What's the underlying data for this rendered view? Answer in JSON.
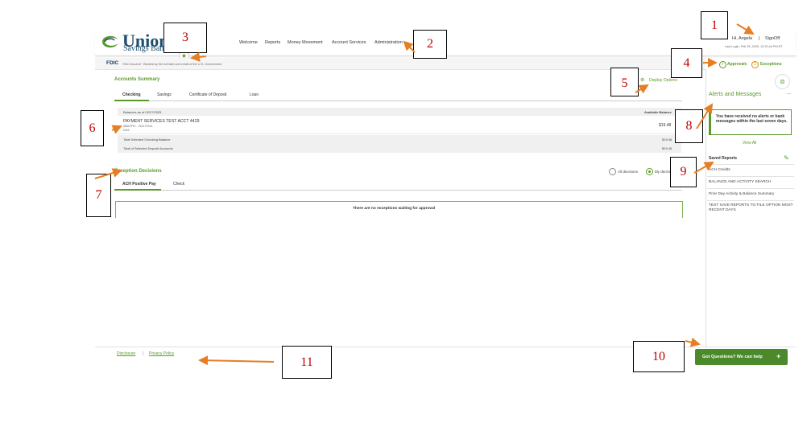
{
  "bank": {
    "name_top": "Union",
    "name_bottom": "Savings Bank"
  },
  "nav": [
    "Welcome",
    "Reports",
    "Money Movement",
    "Account Services",
    "Administration"
  ],
  "user": {
    "greeting": "Hi, Angela",
    "separator": "|",
    "signoff": "SignOff",
    "last_login": "Last Login: Feb 25, 2025, 12:20:44 PM ET"
  },
  "fdic": {
    "logo": "FDIC",
    "text": "FDIC-Insured · Backed by the full faith and credit of the U.S. Government"
  },
  "approvals": {
    "approvals_label": "Approvals",
    "exceptions_label": "Exceptions",
    "exceptions_icon": "1"
  },
  "accounts": {
    "title": "Accounts Summary",
    "display_options": "Display Options",
    "tabs": [
      "Checking",
      "Savings",
      "Certificate of Deposit",
      "Loan"
    ],
    "balances_as_of": "Balances as of 02/27/2025",
    "available_balance_header": "Available Balance",
    "account_name": "PAYMENT SERVICES TEST ACCT 4429",
    "account_detail1": "ABA/TRC - 221172241",
    "account_detail2": "DDA",
    "account_balance": "$19.48",
    "total_checking_label": "Total Selected Checking Balance",
    "total_checking_value": "$19.48",
    "total_deposit_label": "Total of Selected Deposit Accounts",
    "total_deposit_value": "$19.48"
  },
  "exceptions": {
    "title": "Exception Decisions",
    "tabs": [
      "ACH Positive Pay",
      "Check"
    ],
    "radio_all": "All decisions",
    "radio_my": "My decisions",
    "empty_message": "There are no exceptions waiting for approval"
  },
  "alerts": {
    "title": "Alerts and Messages",
    "more": "...",
    "message": "You have received no alerts or bank messages within the last seven days.",
    "view_all": "View All"
  },
  "saved_reports": {
    "title": "Saved Reports",
    "items": [
      "ACH Credits",
      "BALANCE AND ACTIVITY SEARCH",
      "Prior Day Activity & Balance Summary",
      "TEST SAVE REPORTS TO FILE OPTION MOST RECENT DAYS"
    ]
  },
  "footer": {
    "disclosure": "Disclosure",
    "separator": "|",
    "privacy": "Privacy Policy"
  },
  "help": {
    "label": "Got Questions? We can help",
    "plus": "+"
  },
  "callouts": [
    "1",
    "2",
    "3",
    "4",
    "5",
    "6",
    "7",
    "8",
    "9",
    "10",
    "11"
  ],
  "colors": {
    "accent": "#5a9a2a",
    "brand": "#1f4e6d",
    "callout_text": "#c00000",
    "arrow": "#e67e22"
  }
}
